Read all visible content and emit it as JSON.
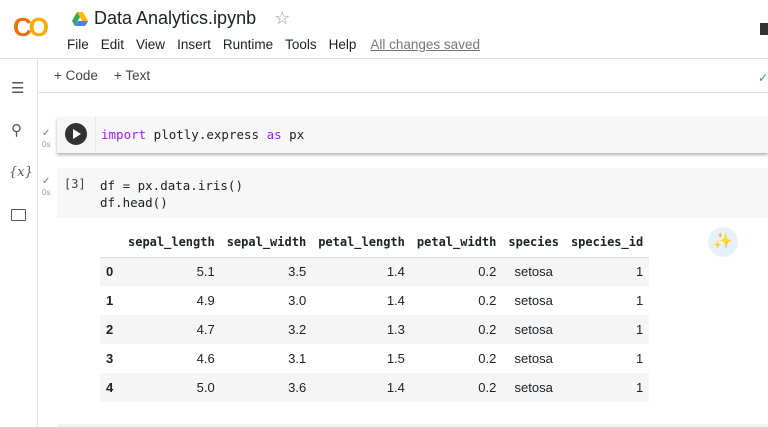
{
  "app": {
    "logo": "CO",
    "title": "Data Analytics.ipynb",
    "menu": [
      "File",
      "Edit",
      "View",
      "Insert",
      "Runtime",
      "Tools",
      "Help"
    ],
    "saved_status": "All changes saved"
  },
  "toolbar": {
    "add_code": "+ Code",
    "add_text": "+ Text"
  },
  "sidebar": {
    "icons": [
      "table-of-contents-icon",
      "search-icon",
      "variables-icon",
      "folder-icon"
    ],
    "variables_glyph": "{x}"
  },
  "cells": [
    {
      "status": "✓",
      "time": "0s",
      "code_kw": "import",
      "code_mid": " plotly.express ",
      "code_kw2": "as",
      "code_end": " px"
    },
    {
      "status": "✓",
      "time": "0s",
      "prompt": "[3]",
      "lines": [
        "df = px.data.iris()",
        "df.head()"
      ]
    }
  ],
  "table": {
    "columns": [
      "",
      "sepal_length",
      "sepal_width",
      "petal_length",
      "petal_width",
      "species",
      "species_id"
    ],
    "rows": [
      [
        "0",
        "5.1",
        "3.5",
        "1.4",
        "0.2",
        "setosa",
        "1"
      ],
      [
        "1",
        "4.9",
        "3.0",
        "1.4",
        "0.2",
        "setosa",
        "1"
      ],
      [
        "2",
        "4.7",
        "3.2",
        "1.3",
        "0.2",
        "setosa",
        "1"
      ],
      [
        "3",
        "4.6",
        "3.1",
        "1.5",
        "0.2",
        "setosa",
        "1"
      ],
      [
        "4",
        "5.0",
        "3.6",
        "1.4",
        "0.2",
        "setosa",
        "1"
      ]
    ]
  }
}
